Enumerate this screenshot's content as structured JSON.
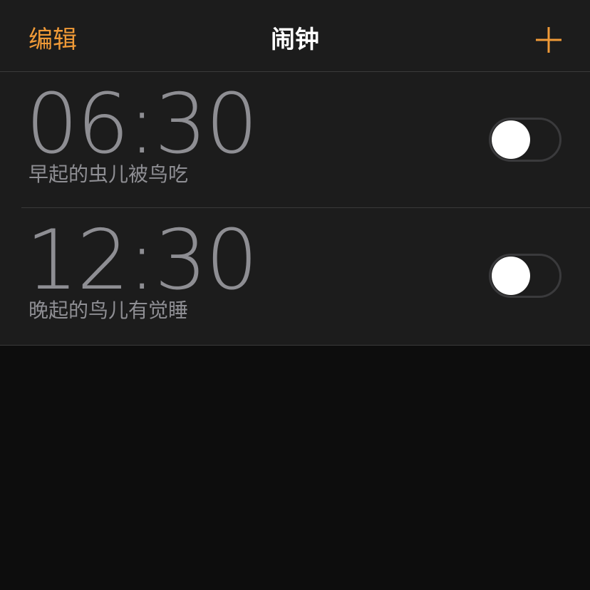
{
  "nav": {
    "edit_label": "编辑",
    "title": "闹钟",
    "add_icon": "plus-icon",
    "accent_color": "#f09a37"
  },
  "alarms": [
    {
      "time": "06:30",
      "label": "早起的虫儿被鸟吃",
      "enabled": false
    },
    {
      "time": "12:30",
      "label": "晚起的鸟儿有觉睡",
      "enabled": false
    }
  ]
}
